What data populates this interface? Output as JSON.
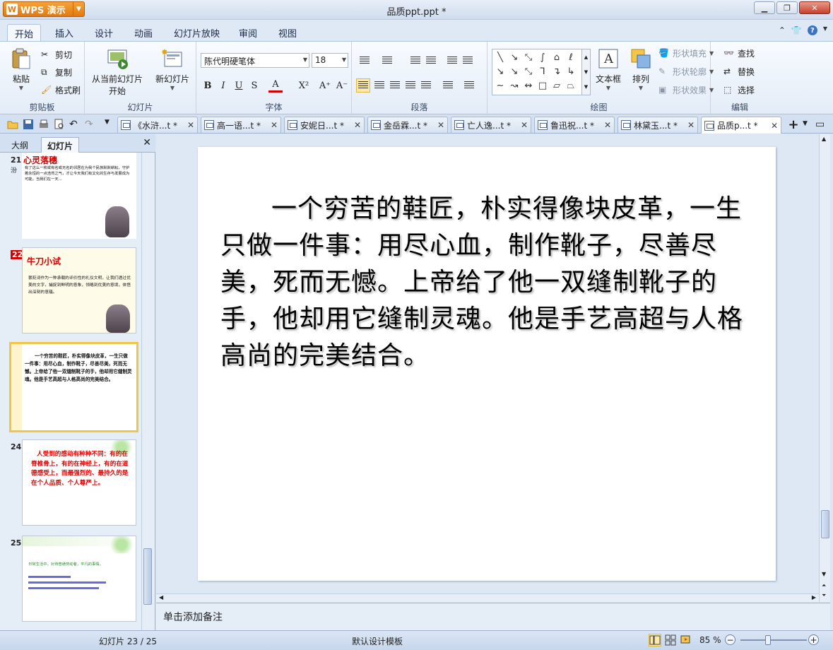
{
  "app": {
    "name": "WPS 演示",
    "logo": "W",
    "doc_title": "品质ppt.ppt *"
  },
  "menu": {
    "tabs": [
      "开始",
      "插入",
      "设计",
      "动画",
      "幻灯片放映",
      "审阅",
      "视图"
    ],
    "active": "开始"
  },
  "ribbon": {
    "clipboard": {
      "label": "剪贴板",
      "paste": "粘贴",
      "cut": "剪切",
      "copy": "复制",
      "format_painter": "格式刷"
    },
    "slides": {
      "label": "幻灯片",
      "play_from_current_line1": "从当前幻灯片",
      "play_from_current_line2": "开始",
      "new_slide": "新幻灯片"
    },
    "font": {
      "label": "字体",
      "font_name": "陈代明硬笔体",
      "font_size": "18",
      "bold": "B",
      "italic": "I",
      "underline": "U",
      "shadow": "S",
      "font_color": "A",
      "superscript": "X²",
      "grow": "A⁺",
      "shrink": "A⁻"
    },
    "paragraph": {
      "label": "段落"
    },
    "drawing": {
      "label": "绘图",
      "textbox": "文本框",
      "arrange": "排列",
      "shape_fill": "形状填充",
      "shape_outline": "形状轮廓",
      "shape_effects": "形状效果"
    },
    "edit": {
      "label": "编辑",
      "find": "查找",
      "replace": "替换",
      "select": "选择"
    }
  },
  "doc_tabs": [
    {
      "label": "《水浒...t *",
      "active": false
    },
    {
      "label": "高一语...t *",
      "active": false
    },
    {
      "label": "安妮日...t *",
      "active": false
    },
    {
      "label": "金岳霖...t *",
      "active": false
    },
    {
      "label": "亡人逸...t *",
      "active": false
    },
    {
      "label": "鲁迅祝...t *",
      "active": false
    },
    {
      "label": "林黛玉...t *",
      "active": false
    },
    {
      "label": "品质p...t *",
      "active": true
    }
  ],
  "left_pane": {
    "tab_outline": "大纲",
    "tab_slides": "幻灯片",
    "thumbs": [
      {
        "num": "21",
        "title": "心灵落穗",
        "text": "有了这么一枚或有名或无名的邻居在为我个民族默默耕耘，守护着永恒的一点浩然之气，才让今天我们有文化的生存与发展成为可能。当我们在一天…",
        "side_char": "汾"
      },
      {
        "num": "22",
        "title": "牛刀小试",
        "text": "褒贬词作为一种承载的评价性的礼仪文明，让我们透过优美的文字，捕捉到鲜明的意象，领略到优美的意境，体悟出深刻的意蕴。"
      },
      {
        "num": "23",
        "text": "一个穷苦的鞋匠，朴实得像块皮革，一生只做一件事：用尽心血，制作靴子，尽善尽美，死而无憾。上帝给了他一双缝制靴子的手，他却用它缝制灵魂。他是手艺高超与人格高尚的完美结合。"
      },
      {
        "num": "24",
        "text": "人受到的感动有种种不同：有的在脊椎骨上，有的在神经上，有的在道德感受上，而最强烈的、最持久的是在个人品质、个人尊严上。"
      },
      {
        "num": "25",
        "text": "日常生活中，对待普通劳动者，平凡的事情。"
      }
    ]
  },
  "slide": {
    "text": "一个穷苦的鞋匠，朴实得像块皮革，一生只做一件事：用尽心血，制作靴子，尽善尽美，死而无憾。上帝给了他一双缝制靴子的手，他却用它缝制灵魂。他是手艺高超与人格高尚的完美结合。"
  },
  "notes_placeholder": "单击添加备注",
  "status": {
    "slide_info": "幻灯片 23 / 25",
    "template": "默认设计模板",
    "zoom": "85 %",
    "zoom_fraction": 0.42
  }
}
